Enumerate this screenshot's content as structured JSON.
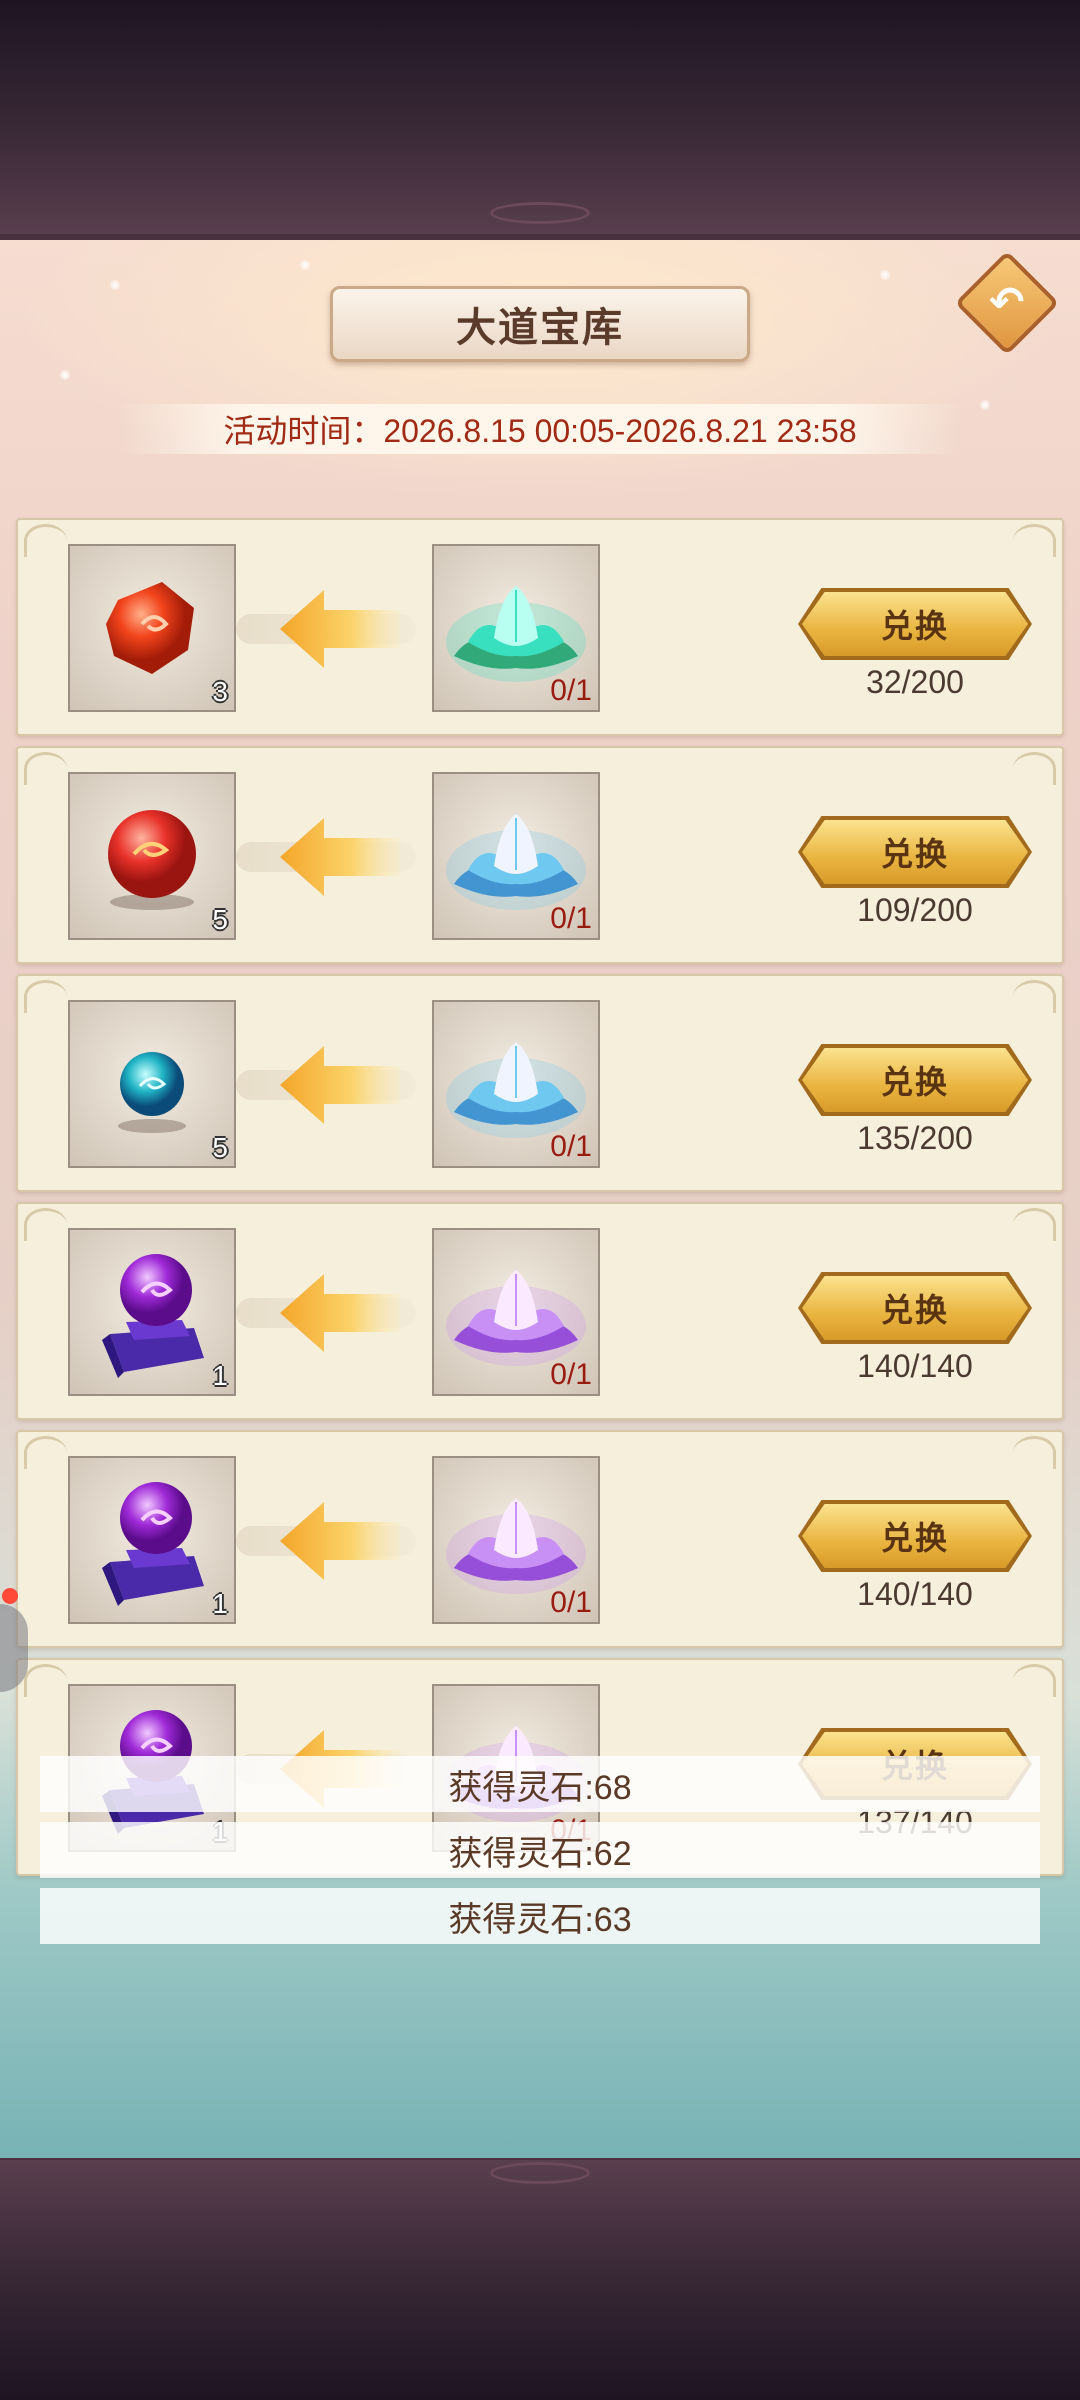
{
  "header": {
    "title": "大道宝库",
    "event_time": "活动时间：2026.8.15 00:05-2026.8.21 23:58",
    "back_label": "↶"
  },
  "rows": [
    {
      "cost_item": "red-gem-icon",
      "cost_qty": "3",
      "reward_item": "green-lotus-icon",
      "reward_progress": "0/1",
      "button": "兑换",
      "limit": "32/200"
    },
    {
      "cost_item": "red-orb-icon",
      "cost_qty": "5",
      "reward_item": "blue-lotus-icon",
      "reward_progress": "0/1",
      "button": "兑换",
      "limit": "109/200"
    },
    {
      "cost_item": "cyan-orb-icon",
      "cost_qty": "5",
      "reward_item": "blue-lotus-icon",
      "reward_progress": "0/1",
      "button": "兑换",
      "limit": "135/200"
    },
    {
      "cost_item": "purple-crystal-ball-icon",
      "cost_qty": "1",
      "reward_item": "purple-lotus-icon",
      "reward_progress": "0/1",
      "button": "兑换",
      "limit": "140/140"
    },
    {
      "cost_item": "purple-crystal-ball-icon",
      "cost_qty": "1",
      "reward_item": "purple-lotus-icon",
      "reward_progress": "0/1",
      "button": "兑换",
      "limit": "140/140"
    },
    {
      "cost_item": "purple-crystal-ball-icon",
      "cost_qty": "1",
      "reward_item": "purple-lotus-icon",
      "reward_progress": "0/1",
      "button": "兑换",
      "limit": "137/140"
    }
  ],
  "toasts": [
    "获得灵石:68",
    "获得灵石:62",
    "获得灵石:63"
  ],
  "colors": {
    "panel_cream": "#f5efdc",
    "button_gold": "#e9b43f",
    "progress_red": "#9a1b10",
    "time_red": "#a02a14"
  }
}
